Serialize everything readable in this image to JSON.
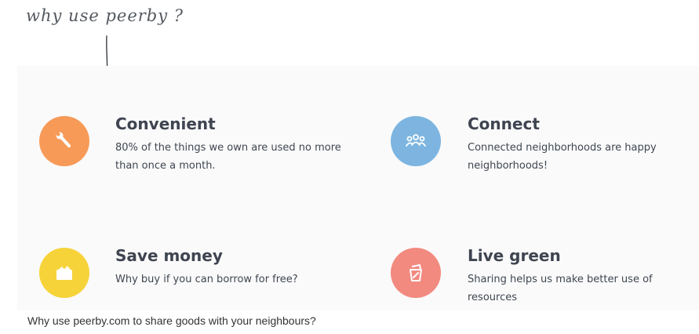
{
  "header": {
    "handwritten_title": "why use peerby ?"
  },
  "features": [
    {
      "title": "Convenient",
      "description": "80% of the things we own are used no more than once a month.",
      "icon": "wrench-icon",
      "color": "#f79a58"
    },
    {
      "title": "Connect",
      "description": "Connected neighborhoods are happy neighborhoods!",
      "icon": "people-icon",
      "color": "#7db5e0"
    },
    {
      "title": "Save money",
      "description": "Why buy if you can borrow for free?",
      "icon": "wallet-icon",
      "color": "#f7d33a"
    },
    {
      "title": "Live green",
      "description": "Sharing helps us make better use of resources",
      "icon": "recycle-icon",
      "color": "#f28a80"
    }
  ],
  "caption": "Why use peerby.com to share goods with your neighbours?"
}
